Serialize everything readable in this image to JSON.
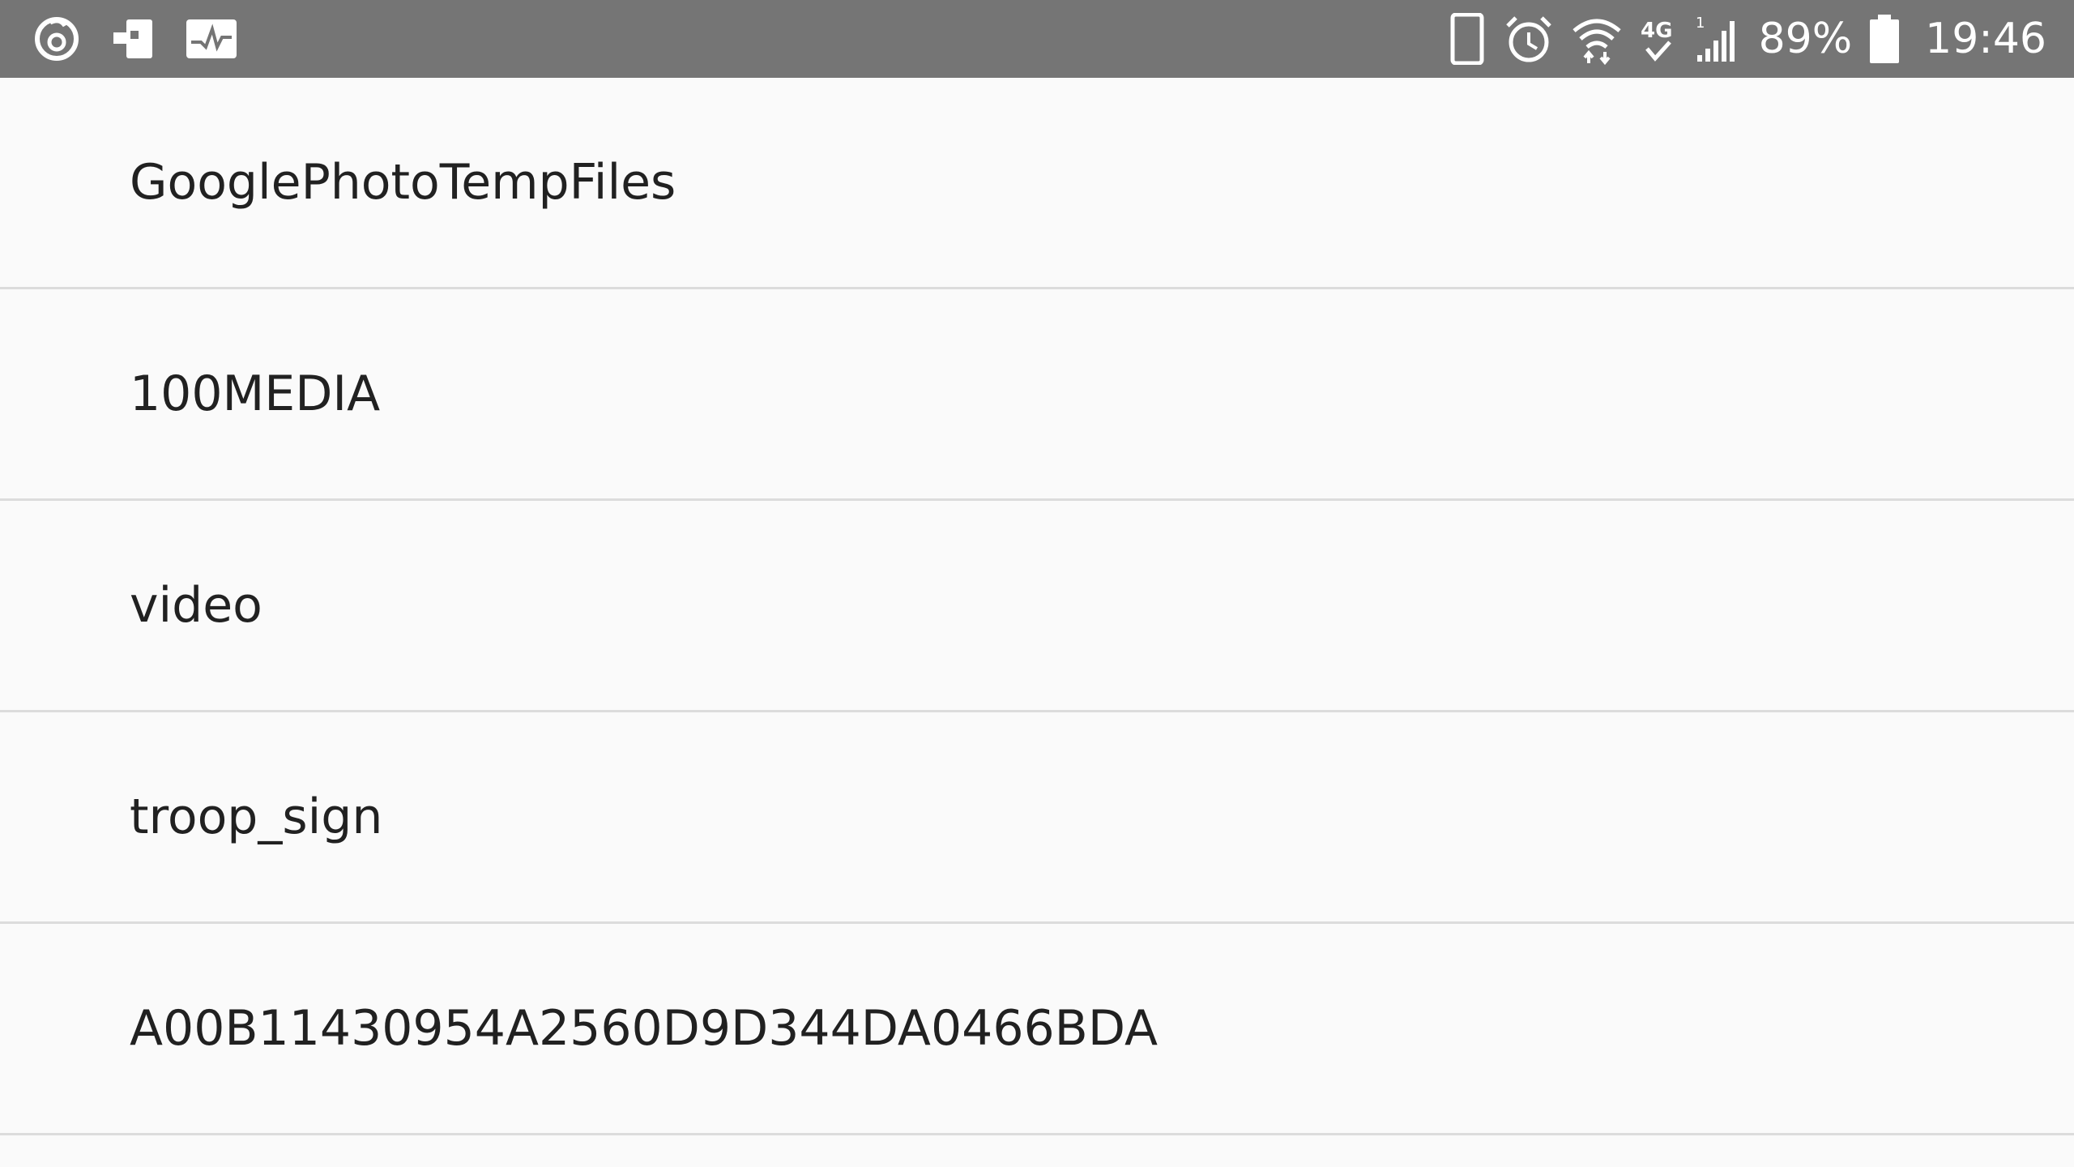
{
  "status_bar": {
    "left_icons": [
      "netease-music-icon",
      "app-transfer-icon",
      "activity-monitor-icon"
    ],
    "right_icons": [
      "phone-icon",
      "alarm-icon",
      "wifi-icon",
      "4g-icon",
      "signal-icon"
    ],
    "battery_percent": "89%",
    "battery_level": 0.89,
    "time": "19:46"
  },
  "list": {
    "items": [
      {
        "label": "GooglePhotoTempFiles"
      },
      {
        "label": "100MEDIA"
      },
      {
        "label": "video"
      },
      {
        "label": "troop_sign"
      },
      {
        "label": "A00B11430954A2560D9D344DA0466BDA"
      }
    ]
  },
  "colors": {
    "status_bar_bg": "#757575",
    "list_bg": "#fafafa",
    "divider": "#dcdcdc",
    "text": "#212121"
  }
}
